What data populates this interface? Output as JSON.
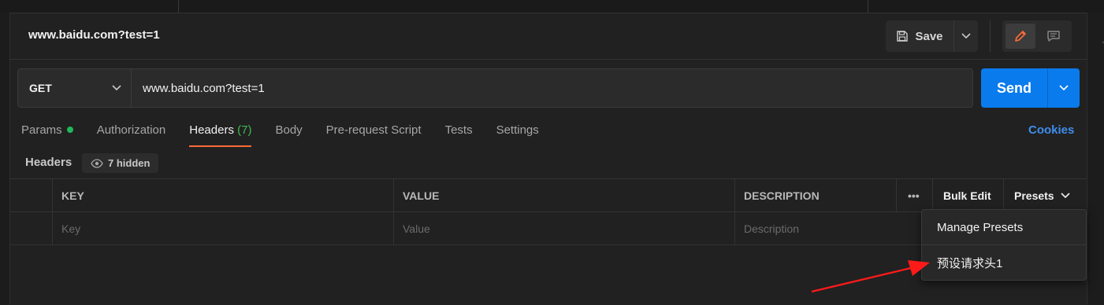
{
  "request": {
    "title": "www.baidu.com?test=1",
    "method": "GET",
    "url": "www.baidu.com?test=1"
  },
  "toolbar": {
    "save_label": "Save",
    "send_label": "Send"
  },
  "tabs": [
    {
      "label": "Params",
      "status": "green-dot"
    },
    {
      "label": "Authorization"
    },
    {
      "label": "Headers",
      "count": "(7)",
      "active": true
    },
    {
      "label": "Body"
    },
    {
      "label": "Pre-request Script"
    },
    {
      "label": "Tests"
    },
    {
      "label": "Settings"
    }
  ],
  "cookies_label": "Cookies",
  "headers_section": {
    "label": "Headers",
    "hidden_count_label": "7 hidden"
  },
  "table": {
    "columns": {
      "key": "KEY",
      "value": "VALUE",
      "description": "DESCRIPTION"
    },
    "more_label": "•••",
    "bulk_edit_label": "Bulk Edit",
    "presets_label": "Presets",
    "placeholders": {
      "key": "Key",
      "value": "Value",
      "description": "Description"
    }
  },
  "presets_menu": {
    "items": [
      "Manage Presets",
      "预设请求头1"
    ]
  },
  "colors": {
    "accent_blue": "#097bed",
    "active_tab_underline": "#ff6c37",
    "params_dot": "#1fb75a",
    "annotation_arrow": "#ff1a1a"
  },
  "icons": [
    "save-icon",
    "chevron-down-icon",
    "pencil-icon",
    "comment-icon",
    "eye-icon"
  ]
}
